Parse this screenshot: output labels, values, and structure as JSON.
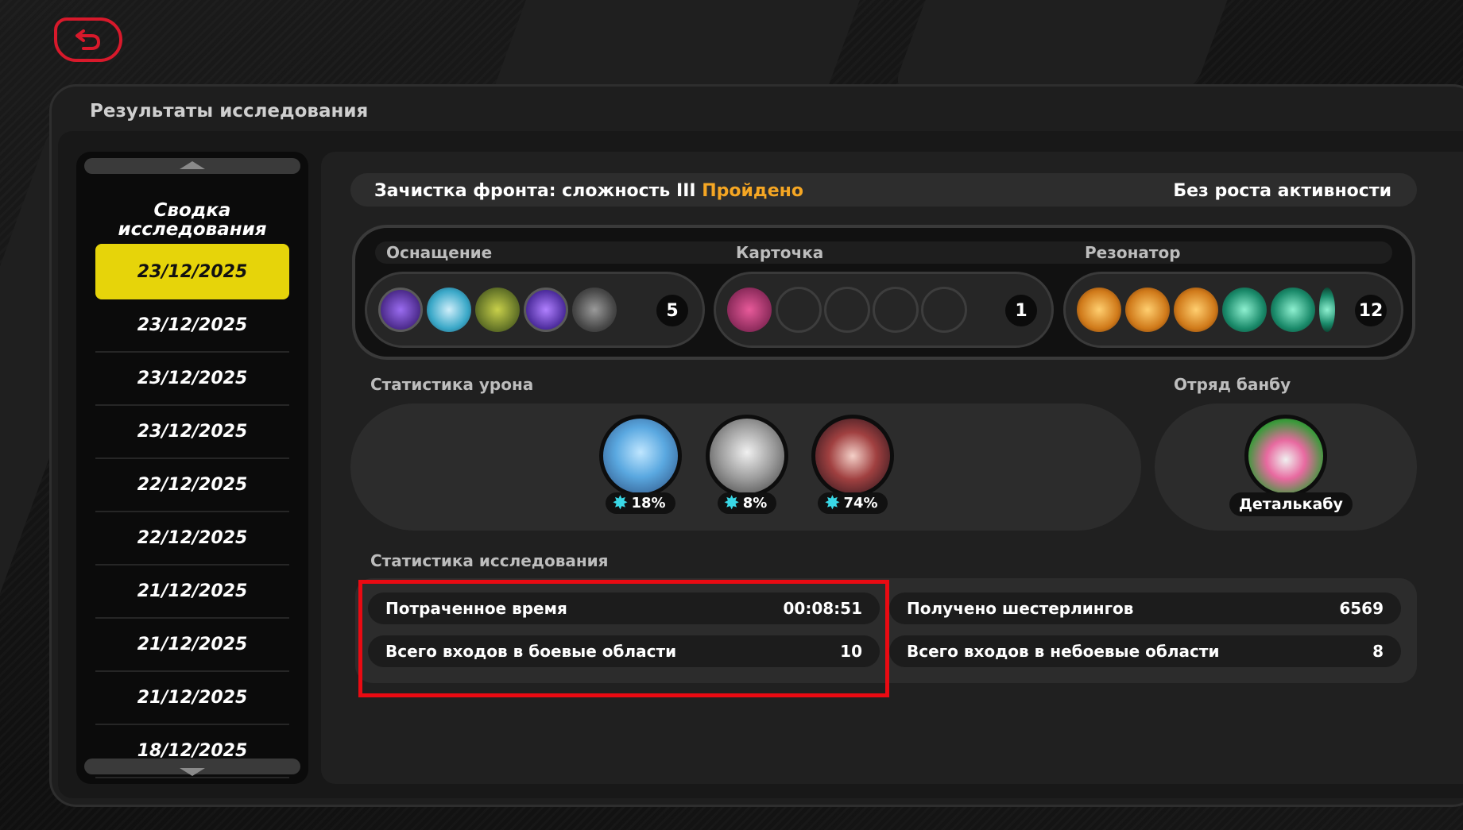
{
  "panel": {
    "title": "Результаты исследования"
  },
  "sidebar": {
    "heading": "Сводка исследования",
    "dates": [
      "23/12/2025",
      "23/12/2025",
      "23/12/2025",
      "23/12/2025",
      "22/12/2025",
      "22/12/2025",
      "21/12/2025",
      "21/12/2025",
      "21/12/2025",
      "18/12/2025"
    ],
    "active_index": 0
  },
  "summary": {
    "mode_label": "Зачистка фронта: сложность III",
    "status": "Пройдено",
    "activity": "Без роста активности"
  },
  "equipment": {
    "headers": {
      "equipment": "Оснащение",
      "card": "Карточка",
      "resonator": "Резонатор"
    },
    "equipment_count": "5",
    "card_count": "1",
    "resonator_count": "12"
  },
  "damage": {
    "label": "Статистика урона",
    "agents": [
      {
        "pct": "18%"
      },
      {
        "pct": "8%"
      },
      {
        "pct": "74%"
      }
    ]
  },
  "bangboo": {
    "label": "Отряд банбу",
    "name": "Деталькабу"
  },
  "stats": {
    "label": "Статистика исследования",
    "time_label": "Потраченное время",
    "time_value": "00:08:51",
    "combat_label": "Всего входов в боевые области",
    "combat_value": "10",
    "gears_label": "Получено шестерлингов",
    "gears_value": "6569",
    "noncombat_label": "Всего входов в небоевые области",
    "noncombat_value": "8"
  },
  "colors": {
    "accent_yellow": "#e6d40a",
    "status_orange": "#f5a623",
    "highlight_red": "#ea0a12",
    "cyan": "#3ad8e6"
  }
}
